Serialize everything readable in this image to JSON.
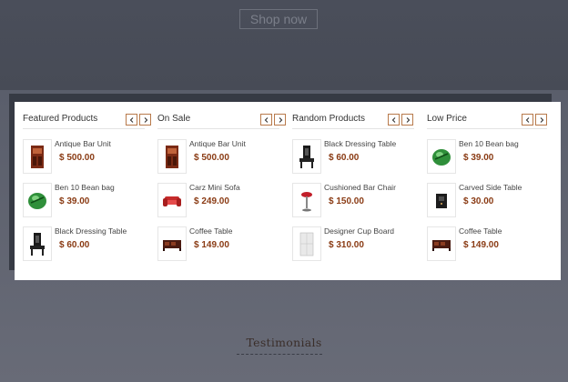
{
  "hero": {
    "shop_now_label": "Shop now"
  },
  "columns": [
    {
      "title": "Featured Products",
      "items": [
        {
          "name": "Antique Bar Unit",
          "price": "$ 500.00",
          "icon": "bar-unit"
        },
        {
          "name": "Ben 10 Bean bag",
          "price": "$ 39.00",
          "icon": "bean-bag"
        },
        {
          "name": "Black Dressing Table",
          "price": "$ 60.00",
          "icon": "dressing-table"
        }
      ]
    },
    {
      "title": "On Sale",
      "items": [
        {
          "name": "Antique Bar Unit",
          "price": "$ 500.00",
          "icon": "bar-unit"
        },
        {
          "name": "Carz Mini Sofa",
          "price": "$ 249.00",
          "icon": "mini-sofa"
        },
        {
          "name": "Coffee Table",
          "price": "$ 149.00",
          "icon": "coffee-table"
        }
      ]
    },
    {
      "title": "Random Products",
      "items": [
        {
          "name": "Black Dressing Table",
          "price": "$ 60.00",
          "icon": "dressing-table"
        },
        {
          "name": "Cushioned Bar Chair",
          "price": "$ 150.00",
          "icon": "bar-chair"
        },
        {
          "name": "Designer Cup Board",
          "price": "$ 310.00",
          "icon": "cup-board"
        }
      ]
    },
    {
      "title": "Low Price",
      "items": [
        {
          "name": "Ben 10 Bean bag",
          "price": "$ 39.00",
          "icon": "bean-bag"
        },
        {
          "name": "Carved Side Table",
          "price": "$ 30.00",
          "icon": "side-table"
        },
        {
          "name": "Coffee Table",
          "price": "$ 149.00",
          "icon": "coffee-table"
        }
      ]
    }
  ],
  "section": {
    "testimonials_label": "Testimonials"
  },
  "colors": {
    "accent": "#b87a4b",
    "price": "#8a3b14",
    "band": "#5d6170"
  }
}
